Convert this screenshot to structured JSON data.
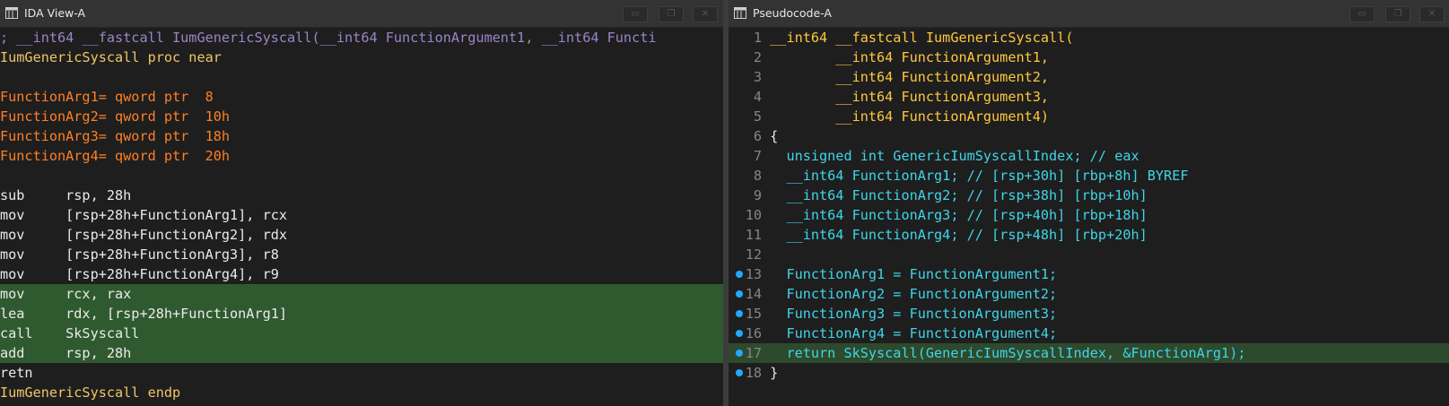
{
  "left": {
    "title": "IDA View-A",
    "lines": [
      "; __int64 __fastcall IumGenericSyscall(__int64 FunctionArgument1, __int64 Functi",
      "IumGenericSyscall proc near",
      "",
      "FunctionArg1= qword ptr  8",
      "FunctionArg2= qword ptr  10h",
      "FunctionArg3= qword ptr  18h",
      "FunctionArg4= qword ptr  20h",
      "",
      "sub     rsp, 28h",
      "mov     [rsp+28h+FunctionArg1], rcx",
      "mov     [rsp+28h+FunctionArg2], rdx",
      "mov     [rsp+28h+FunctionArg3], r8",
      "mov     [rsp+28h+FunctionArg4], r9",
      "mov     rcx, rax",
      "lea     rdx, [rsp+28h+FunctionArg1]",
      "call    SkSyscall",
      "add     rsp, 28h",
      "retn",
      "IumGenericSyscall endp"
    ]
  },
  "right": {
    "title": "Pseudocode-A",
    "line_numbers": [
      "1",
      "2",
      "3",
      "4",
      "5",
      "6",
      "7",
      "8",
      "9",
      "10",
      "11",
      "12",
      "13",
      "14",
      "15",
      "16",
      "17",
      "18"
    ],
    "lines": [
      "__int64 __fastcall IumGenericSyscall(",
      "        __int64 FunctionArgument1,",
      "        __int64 FunctionArgument2,",
      "        __int64 FunctionArgument3,",
      "        __int64 FunctionArgument4)",
      "{",
      "  unsigned int GenericIumSyscallIndex; // eax",
      "  __int64 FunctionArg1; // [rsp+30h] [rbp+8h] BYREF",
      "  __int64 FunctionArg2; // [rsp+38h] [rbp+10h]",
      "  __int64 FunctionArg3; // [rsp+40h] [rbp+18h]",
      "  __int64 FunctionArg4; // [rsp+48h] [rbp+20h]",
      "",
      "  FunctionArg1 = FunctionArgument1;",
      "  FunctionArg2 = FunctionArgument2;",
      "  FunctionArg3 = FunctionArgument3;",
      "  FunctionArg4 = FunctionArgument4;",
      "  return SkSyscall(GenericIumSyscallIndex, &FunctionArg1);",
      "}"
    ]
  },
  "colors": {
    "background": "#1e1e1e",
    "highlight": "#2f5a2f",
    "breakpoint": "#1fa9ff"
  }
}
